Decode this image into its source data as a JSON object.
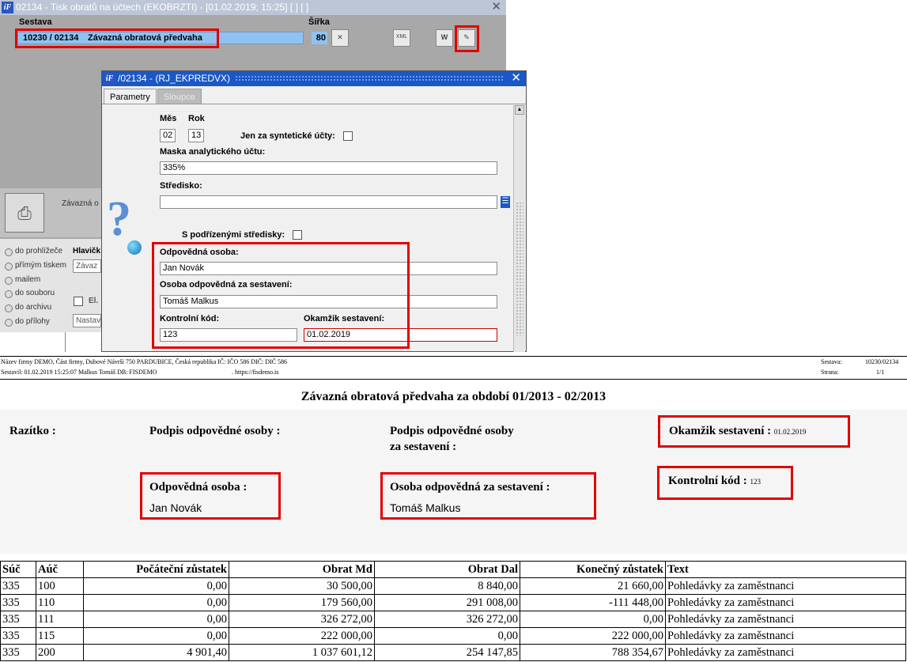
{
  "back_window": {
    "title": "02134 - Tisk obratů na účtech (EKOBRZTI) - [01.02.2019; 15:25]  [ ]  [ ]",
    "sestava_label": "Sestava",
    "sestava_code": "10230 / 02134",
    "sestava_name": "Závazná obratová předvaha",
    "sirka_label": "Šířka",
    "sirka_value": "80",
    "toolbar_icons": [
      "excel-icon",
      "xml-icon",
      "word-icon",
      "edit-icon"
    ],
    "xml_label": "XML",
    "word_label": "W",
    "panel_text": "Závazná o",
    "output_options": [
      "do prohlížeče",
      "přímým tiskem",
      "mailem",
      "do souboru",
      "do archivu",
      "do přílohy"
    ],
    "hlavicka_label": "Hlavičk",
    "hlavicka_value": "Závaz",
    "el_label": "El.",
    "nastav_value": "Nastav"
  },
  "dialog": {
    "title": "/02134 - (RJ_EKPREDVX)",
    "tabs": [
      "Parametry",
      "Sloupce"
    ],
    "mes_label": "Měs",
    "mes_value": "02",
    "rok_label": "Rok",
    "rok_value": "13",
    "syntetic_label": "Jen za syntetické účty:",
    "maska_label": "Maska analytického účtu:",
    "maska_value": "335%",
    "stredisko_label": "Středisko:",
    "stredisko_value": "",
    "podrizene_label": "S podřízenými středisky:",
    "odpovedna_label": "Odpovědná osoba:",
    "odpovedna_value": "Jan Novák",
    "osoba_sestaveni_label": "Osoba odpovědná za sestavení:",
    "osoba_sestaveni_value": "Tomáš Malkus",
    "kontrolni_label": "Kontrolní kód:",
    "kontrolni_value": "123",
    "okamzik_label": "Okamžik sestavení:",
    "okamzik_value": "01.02.2019"
  },
  "report": {
    "header_line1": "Název firmy DEMO, Část firmy, Dubové Návrší 750 PARDUBICE, Česká republika  IČ: IČO 586  DIČ: DIČ 586",
    "header_line2": "Sestavil: 01.02.2019 15:25:07 Malkus Tomáš  DB: FISDEMO",
    "header_url": ". https://fisdemo.is",
    "sestava_label": "Sestava:",
    "sestava_value": "10230/02134",
    "strana_label": "Strana:",
    "strana_value": "1/1",
    "title": "Závazná obratová předvaha za období 01/2013 - 02/2013",
    "razitko_label": "Razítko :",
    "podpis_odpovedne_label": "Podpis odpovědné osoby :",
    "podpis_sestaveni_line1": "Podpis odpovědné osoby",
    "podpis_sestaveni_line2": "za sestavení :",
    "okamzik_label": "Okamžik sestavení :",
    "okamzik_value": "01.02.2019",
    "kontrolni_label": "Kontrolní kód :",
    "kontrolni_value": "123",
    "odpovedna_label": "Odpovědná osoba :",
    "odpovedna_value": "Jan Novák",
    "osoba_sestaveni_label": "Osoba odpovědná za sestavení :",
    "osoba_sestaveni_value": "Tomáš Malkus",
    "table": {
      "columns": [
        "Súč",
        "Aúč",
        "Počáteční zůstatek",
        "Obrat Md",
        "Obrat Dal",
        "Konečný zůstatek",
        "Text"
      ],
      "rows": [
        [
          "335",
          "100",
          "0,00",
          "30 500,00",
          "8 840,00",
          "21 660,00",
          "Pohledávky za zaměstnanci"
        ],
        [
          "335",
          "110",
          "0,00",
          "179 560,00",
          "291 008,00",
          "-111 448,00",
          "Pohledávky za zaměstnanci"
        ],
        [
          "335",
          "111",
          "0,00",
          "326 272,00",
          "326 272,00",
          "0,00",
          "Pohledávky za zaměstnanci"
        ],
        [
          "335",
          "115",
          "0,00",
          "222 000,00",
          "0,00",
          "222 000,00",
          "Pohledávky za zaměstnanci"
        ],
        [
          "335",
          "200",
          "4 901,40",
          "1 037 601,12",
          "254 147,85",
          "788 354,67",
          "Pohledávky za zaměstnanci"
        ]
      ]
    }
  }
}
